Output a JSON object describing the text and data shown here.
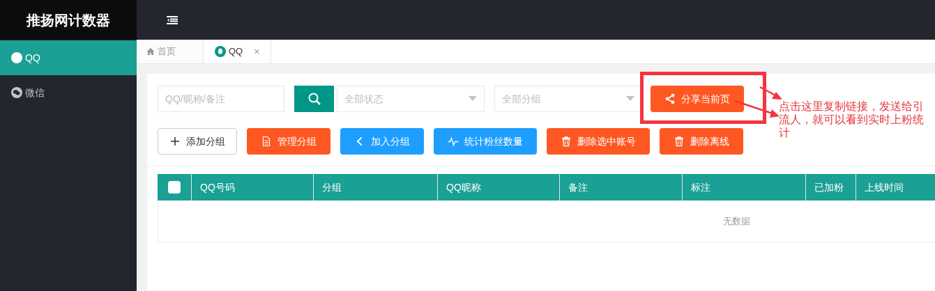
{
  "app": {
    "title": "推扬网计数器"
  },
  "sidebar": {
    "items": [
      {
        "label": "QQ",
        "selected": true
      },
      {
        "label": "微信",
        "selected": false
      }
    ]
  },
  "tabs": [
    {
      "label": "首页",
      "selected": false
    },
    {
      "label": "QQ",
      "selected": true,
      "close": "×"
    }
  ],
  "filters": {
    "search": {
      "placeholder": "QQ/昵称/备注"
    },
    "status": {
      "placeholder": "全部状态"
    },
    "group": {
      "placeholder": "全部分组"
    }
  },
  "share_button": {
    "label": "分享当前页"
  },
  "actions": [
    {
      "label": "添加分组",
      "kind": "add"
    },
    {
      "label": "管理分组",
      "kind": "manage"
    },
    {
      "label": "加入分组",
      "kind": "join"
    },
    {
      "label": "统计粉丝数量",
      "kind": "stats"
    },
    {
      "label": "删除选中账号",
      "kind": "delete"
    },
    {
      "label": "删除离线",
      "kind": "delete"
    }
  ],
  "table": {
    "select_all_checked": false,
    "columns": [
      "QQ号码",
      "分组",
      "QQ昵称",
      "备注",
      "标注",
      "已加粉",
      "上线时间"
    ],
    "empty": "无数据"
  },
  "annotation": {
    "note": "点击这里复制链接，发送给引流人，就可以看到实时上粉统计"
  }
}
